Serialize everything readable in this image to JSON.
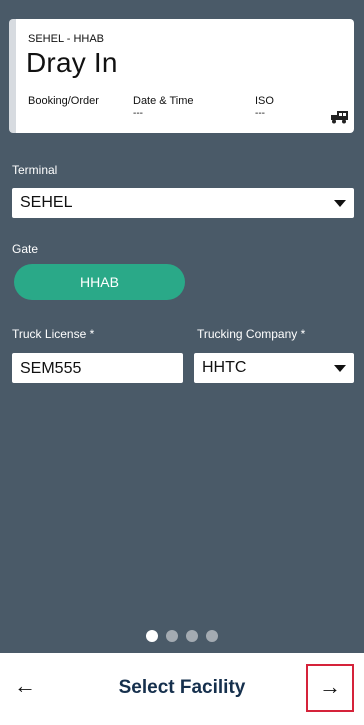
{
  "card": {
    "subtitle": "SEHEL - HHAB",
    "title": "Dray In",
    "columns": [
      {
        "label": "Booking/Order",
        "value": ""
      },
      {
        "label": "Date & Time",
        "value": "---"
      },
      {
        "label": "ISO",
        "value": "---"
      }
    ],
    "icon": "truck-icon"
  },
  "terminal": {
    "label": "Terminal",
    "value": "SEHEL"
  },
  "gate": {
    "label": "Gate",
    "value": "HHAB"
  },
  "truck_license": {
    "label": "Truck License *",
    "value": "SEM555"
  },
  "trucking_company": {
    "label": "Trucking Company *",
    "value": "HHTC"
  },
  "pager": {
    "total": 4,
    "active": 1
  },
  "bottom_bar": {
    "back_glyph": "←",
    "title": "Select Facility",
    "next_glyph": "→"
  },
  "colors": {
    "background": "#4a5a68",
    "accent": "#2aa988",
    "title": "#16304d",
    "highlight": "#d5233a"
  }
}
